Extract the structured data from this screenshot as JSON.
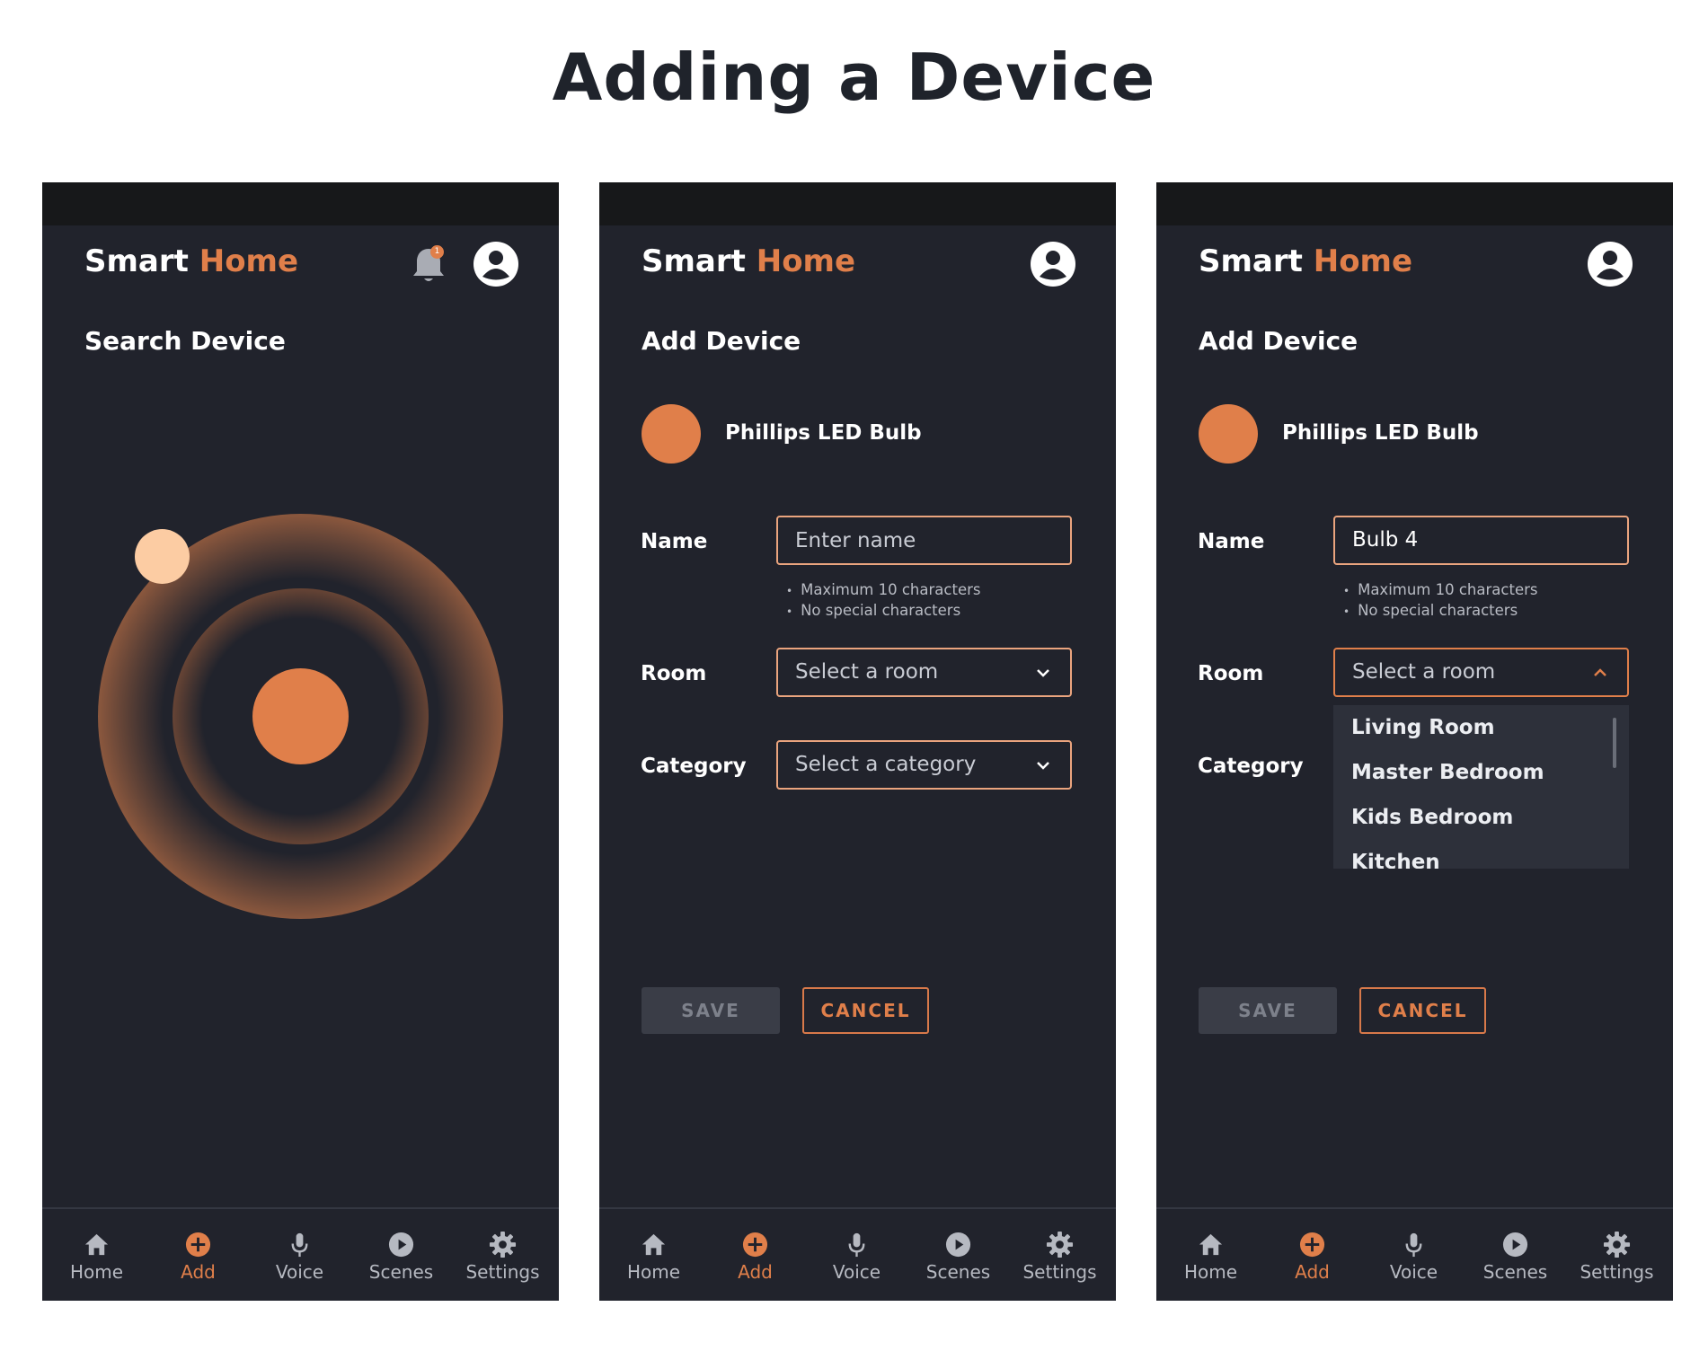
{
  "page": {
    "title": "Adding a Device"
  },
  "colors": {
    "accent": "#e07f4a",
    "background": "#21232c",
    "status_bar": "#17181a",
    "radar_dot": "#fccca3"
  },
  "app": {
    "name_part1": "Smart",
    "name_part2": "Home"
  },
  "screens": {
    "search": {
      "title": "Search Device",
      "notification_count": "1"
    },
    "add_empty": {
      "title": "Add Device",
      "device_name": "Phillips LED Bulb",
      "name_label": "Name",
      "name_placeholder": "Enter name",
      "hints": [
        "Maximum 10 characters",
        "No special characters"
      ],
      "room_label": "Room",
      "room_value": "Select a room",
      "category_label": "Category",
      "category_value": "Select a category",
      "save": "SAVE",
      "cancel": "CANCEL"
    },
    "add_dropdown": {
      "title": "Add Device",
      "device_name": "Phillips LED Bulb",
      "name_label": "Name",
      "name_value": "Bulb 4",
      "hints": [
        "Maximum 10 characters",
        "No special characters"
      ],
      "room_label": "Room",
      "room_value": "Select a room",
      "category_label": "Category",
      "room_options": [
        "Living Room",
        "Master Bedroom",
        "Kids Bedroom",
        "Kitchen"
      ],
      "save": "SAVE",
      "cancel": "CANCEL"
    }
  },
  "nav": {
    "items": [
      {
        "label": "Home",
        "icon": "home-icon"
      },
      {
        "label": "Add",
        "icon": "add-circle-icon",
        "active": true
      },
      {
        "label": "Voice",
        "icon": "microphone-icon"
      },
      {
        "label": "Scenes",
        "icon": "play-circle-icon"
      },
      {
        "label": "Settings",
        "icon": "gear-icon"
      }
    ]
  }
}
